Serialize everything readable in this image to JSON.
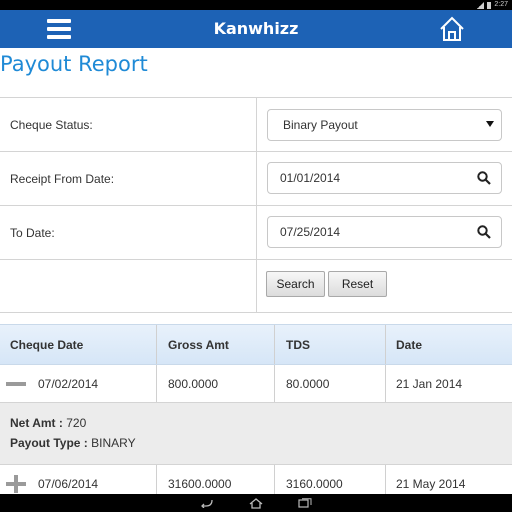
{
  "status_bar": {
    "time": "2:27"
  },
  "app_bar": {
    "title": "Kanwhizz",
    "menu_icon": "menu-icon",
    "home_icon": "home-icon"
  },
  "page": {
    "title": "Payout Report"
  },
  "form": {
    "cheque_status_label": "Cheque Status:",
    "cheque_status_value": "Binary Payout",
    "receipt_from_label": "Receipt From Date:",
    "receipt_from_value": "01/01/2014",
    "to_date_label": "To Date:",
    "to_date_value": "07/25/2014",
    "search_button": "Search",
    "reset_button": "Reset"
  },
  "table": {
    "columns": [
      "Cheque Date",
      "Gross Amt",
      "TDS",
      "Date"
    ],
    "rows": [
      {
        "cheque_date": "07/02/2014",
        "gross_amt": "800.0000",
        "tds": "80.0000",
        "date": "21 Jan 2014",
        "expanded": true,
        "net_amt_label": "Net Amt :",
        "net_amt": "720",
        "payout_type_label": "Payout Type :",
        "payout_type": "BINARY"
      },
      {
        "cheque_date": "07/06/2014",
        "gross_amt": "31600.0000",
        "tds": "3160.0000",
        "date": "21 May 2014",
        "expanded": false
      }
    ]
  },
  "colors": {
    "app_bar": "#1d62b5",
    "title": "#1f8ad6"
  }
}
